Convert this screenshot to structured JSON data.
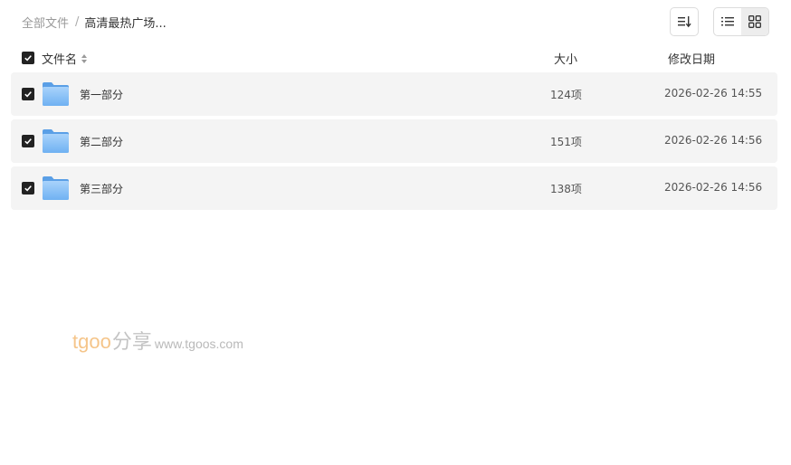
{
  "breadcrumb": {
    "root": "全部文件",
    "separator": "/",
    "current": "高清最热广场..."
  },
  "toolbar": {
    "sort_icon": "sort-lines-icon",
    "view_list_icon": "list-view-icon",
    "view_grid_icon": "grid-view-icon",
    "active_view": "list"
  },
  "table": {
    "columns": {
      "name": "文件名",
      "size": "大小",
      "date": "修改日期"
    },
    "rows": [
      {
        "name": "第一部分",
        "size": "124项",
        "date": "2026-02-26 14:55",
        "checked": true
      },
      {
        "name": "第二部分",
        "size": "151项",
        "date": "2026-02-26 14:56",
        "checked": true
      },
      {
        "name": "第三部分",
        "size": "138项",
        "date": "2026-02-26 14:56",
        "checked": true
      }
    ]
  },
  "watermark": {
    "logo": "tgoo",
    "cn": "分享",
    "url": "www.tgoos.com"
  },
  "colors": {
    "row_bg": "#f4f4f4",
    "checkbox": "#222222",
    "folder": "#7ab8f5",
    "watermark_logo": "#f7c884"
  }
}
